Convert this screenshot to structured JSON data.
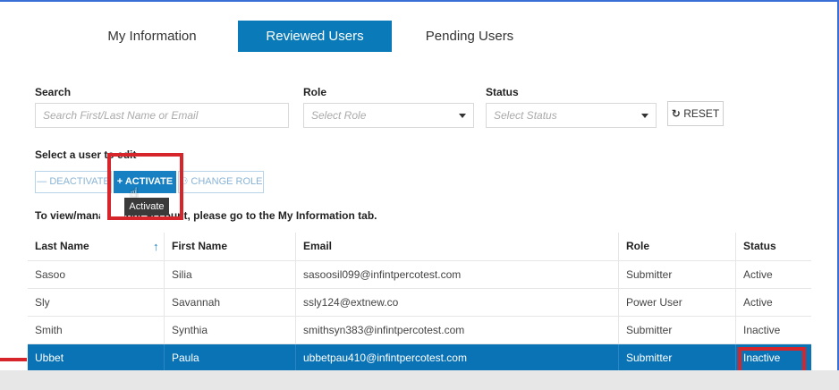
{
  "tabs": [
    {
      "label": "My Information"
    },
    {
      "label": "Reviewed Users",
      "active": true
    },
    {
      "label": "Pending Users"
    }
  ],
  "filters": {
    "search_label": "Search",
    "search_placeholder": "Search First/Last Name or Email",
    "role_label": "Role",
    "role_placeholder": "Select Role",
    "status_label": "Status",
    "status_placeholder": "Select Status",
    "reset_label": "RESET"
  },
  "actions": {
    "select_text": "Select a user to edit",
    "deactivate_label": "DEACTIVATE",
    "activate_label": "ACTIVATE",
    "change_role_label": "CHANGE ROLE",
    "tooltip": "Activate"
  },
  "info_text": "To view/manage your account, please go to the My Information tab.",
  "table": {
    "headers": [
      "Last Name",
      "First Name",
      "Email",
      "Role",
      "Status"
    ],
    "rows": [
      [
        "Sasoo",
        "Silia",
        "sasoosil099@infintpercotest.com",
        "Submitter",
        "Active"
      ],
      [
        "Sly",
        "Savannah",
        "ssly124@extnew.co",
        "Power User",
        "Active"
      ],
      [
        "Smith",
        "Synthia",
        "smithsyn383@infintpercotest.com",
        "Submitter",
        "Inactive"
      ],
      [
        "Ubbet",
        "Paula",
        "ubbetpau410@infintpercotest.com",
        "Submitter",
        "Inactive"
      ]
    ],
    "selected_row": 3
  },
  "colors": {
    "accent": "#0a7ab8",
    "selected_row": "#0a73b5",
    "annotation": "#d6262c"
  },
  "icons": {
    "reset": "refresh-icon",
    "deactivate": "minus-icon",
    "activate": "plus-icon",
    "change_role": "users-icon",
    "sort": "sort-up-arrow-icon"
  }
}
